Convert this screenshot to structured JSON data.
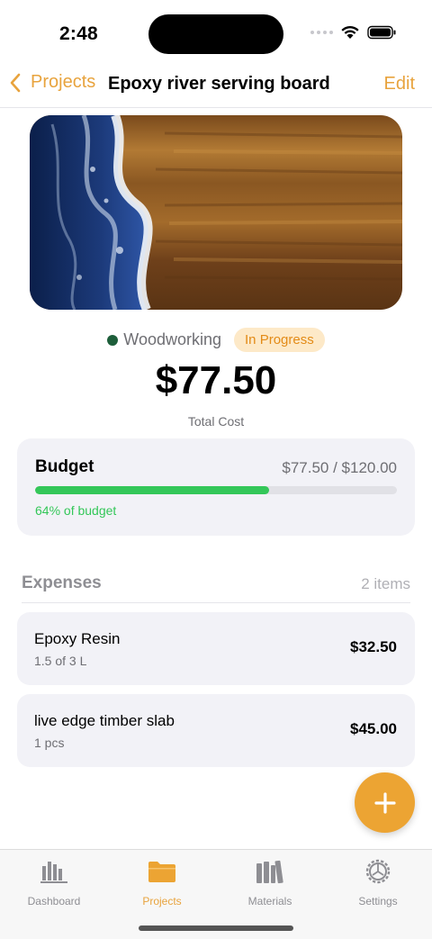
{
  "status_bar": {
    "time": "2:48"
  },
  "nav": {
    "back_label": "Projects",
    "title": "Epoxy river serving board",
    "edit_label": "Edit"
  },
  "project": {
    "category": "Woodworking",
    "category_color": "#1d5e3a",
    "status": "In Progress",
    "total_cost": "$77.50",
    "total_cost_label": "Total Cost"
  },
  "budget": {
    "title": "Budget",
    "values": "$77.50 / $120.00",
    "progress_fraction": 0.646,
    "percent_text": "64% of budget"
  },
  "expenses": {
    "title": "Expenses",
    "count": "2 items",
    "items": [
      {
        "name": "Epoxy Resin",
        "quantity": "1.5 of 3 L",
        "price": "$32.50"
      },
      {
        "name": "live edge timber slab",
        "quantity": "1 pcs",
        "price": "$45.00"
      }
    ]
  },
  "fab": {
    "icon": "plus-icon"
  },
  "tabs": [
    {
      "label": "Dashboard",
      "icon": "bar-chart-icon",
      "active": false
    },
    {
      "label": "Projects",
      "icon": "folder-icon",
      "active": true
    },
    {
      "label": "Materials",
      "icon": "books-icon",
      "active": false
    },
    {
      "label": "Settings",
      "icon": "gear-icon",
      "active": false
    }
  ],
  "colors": {
    "accent": "#e8a33d",
    "progress": "#34c759",
    "card_bg": "#f2f2f7"
  }
}
